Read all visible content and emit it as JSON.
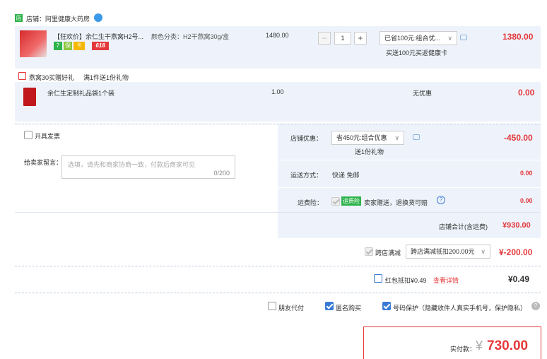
{
  "store": {
    "label": "店铺：阿里健康大药房"
  },
  "item1": {
    "title": "【狂欢价】余仁生干燕窝H2号...",
    "sku": "颜色分类：H2干燕窝30g/盒",
    "price": "1480.00",
    "qty": "1",
    "promo_select": "已省100元:组合优...",
    "promo_note": "买送100元买返健康卡",
    "total": "1380.00",
    "badges": [
      "7",
      "保",
      "卡",
      "618"
    ]
  },
  "gift_banner": {
    "tag": "燕窝30买赠好礼",
    "rule": "满1件送1份礼物"
  },
  "item2": {
    "title": "余仁生定制礼品袋1个装",
    "price": "1.00",
    "promo": "无优惠",
    "total": "0.00"
  },
  "invoice": {
    "label": "开具发票"
  },
  "message": {
    "label": "给卖家留言：",
    "placeholder": "选填，请先和商家协商一致，付款后商家可见",
    "counter": "0/200"
  },
  "shop_discount": {
    "label": "店铺优惠：",
    "select": "省450元:组合优惠",
    "note": "送1份礼物",
    "amount": "-450.00"
  },
  "shipping": {
    "label": "运送方式：",
    "value": "快递 免邮",
    "amount": "0.00"
  },
  "insurance": {
    "label": "运费险：",
    "badge": "运费险",
    "text": "卖家赠送，退换货可赔",
    "amount": "0.00"
  },
  "store_total": {
    "label": "店铺合计(含运费)",
    "amount": "¥930.00"
  },
  "cross_store": {
    "label": "跨店满减",
    "select": "跨店满减抵扣200.00元",
    "amount": "¥-200.00"
  },
  "red_packet": {
    "label": "红包抵扣¥0.49",
    "link": "查看详情",
    "amount": "¥0.49"
  },
  "options": {
    "friend_pay": "朋友代付",
    "anonymous": "匿名购买",
    "phone_protect": "号码保护（隐藏收件人真实手机号，保护隐私）"
  },
  "pay": {
    "label": "实付款：",
    "currency": "¥",
    "amount": "730.00"
  },
  "colors": {
    "accent_red": "#e4393c",
    "panel_blue": "#eef3fb",
    "border_blue": "#b9c7d8",
    "checkbox_blue": "#3a7bd5",
    "badge_green": "#2db34a"
  }
}
